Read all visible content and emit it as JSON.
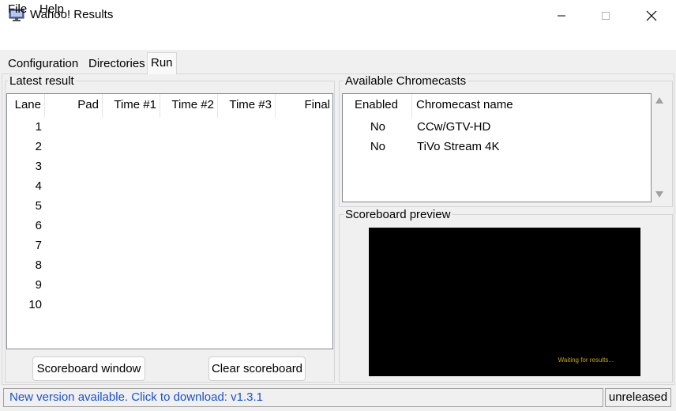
{
  "window": {
    "title": "Wahoo! Results",
    "minimize_icon": "minimize-icon",
    "maximize_icon": "maximize-icon",
    "close_icon": "close-icon",
    "app_icon": "monitor-app-icon"
  },
  "menu": {
    "file": "File",
    "help": "Help"
  },
  "tabs": {
    "configuration": "Configuration",
    "directories": "Directories",
    "run": "Run",
    "active": "run"
  },
  "latest_result": {
    "title": "Latest result",
    "columns": [
      "Lane",
      "Pad",
      "Time #1",
      "Time #2",
      "Time #3",
      "Final"
    ],
    "lanes": [
      "1",
      "2",
      "3",
      "4",
      "5",
      "6",
      "7",
      "8",
      "9",
      "10"
    ]
  },
  "buttons": {
    "scoreboard_window": "Scoreboard window",
    "clear_scoreboard": "Clear scoreboard"
  },
  "chromecasts": {
    "title": "Available Chromecasts",
    "columns": [
      "Enabled",
      "Chromecast name"
    ],
    "rows": [
      {
        "enabled": "No",
        "name": "CCw/GTV-HD"
      },
      {
        "enabled": "No",
        "name": "TiVo Stream 4K"
      }
    ],
    "scroll_up_icon": "scroll-up-arrow-icon",
    "scroll_down_icon": "scroll-down-arrow-icon"
  },
  "preview": {
    "title": "Scoreboard preview",
    "waiting_text": "Waiting for results..."
  },
  "status": {
    "message": "New version available. Click to download: v1.3.1",
    "version": "unreleased"
  },
  "colors": {
    "link": "#1a4fd6",
    "preview_bg": "#000000",
    "waiting_text": "#c8a800"
  }
}
